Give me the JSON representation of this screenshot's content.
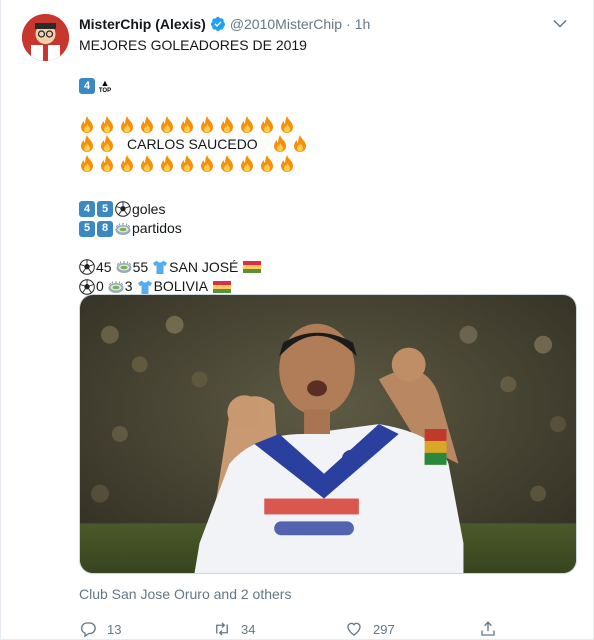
{
  "tweet": {
    "author_name": "MisterChip (Alexis)",
    "handle": "@2010MisterChip",
    "separator": "·",
    "time": "1h",
    "title": "MEJORES GOLEADORES DE 2019",
    "rank_digit": "4",
    "rank_badge": "TOP",
    "player_name": "CARLOS SAUCEDO",
    "goals_digits": [
      "4",
      "5"
    ],
    "goals_label": "goles",
    "matches_digits": [
      "5",
      "8"
    ],
    "matches_label": "partidos",
    "club_goals": "45",
    "club_matches": "55",
    "club_name": "SAN JOSÉ",
    "nat_goals": "0",
    "nat_matches": "3",
    "nat_name": "BOLIVIA",
    "tagged": "Club San Jose Oruro and 2 others",
    "stats": {
      "replies": "13",
      "retweets": "34",
      "likes": "297"
    }
  },
  "colors": {
    "verified": "#1da1f2",
    "keycap": "#3b88c3",
    "muted": "#657786"
  },
  "icons": [
    "verified-badge-icon",
    "caret-down-icon",
    "fire-icon",
    "soccer-ball-icon",
    "stadium-icon",
    "jersey-icon",
    "bolivia-flag-icon",
    "reply-icon",
    "retweet-icon",
    "like-icon",
    "share-icon"
  ]
}
